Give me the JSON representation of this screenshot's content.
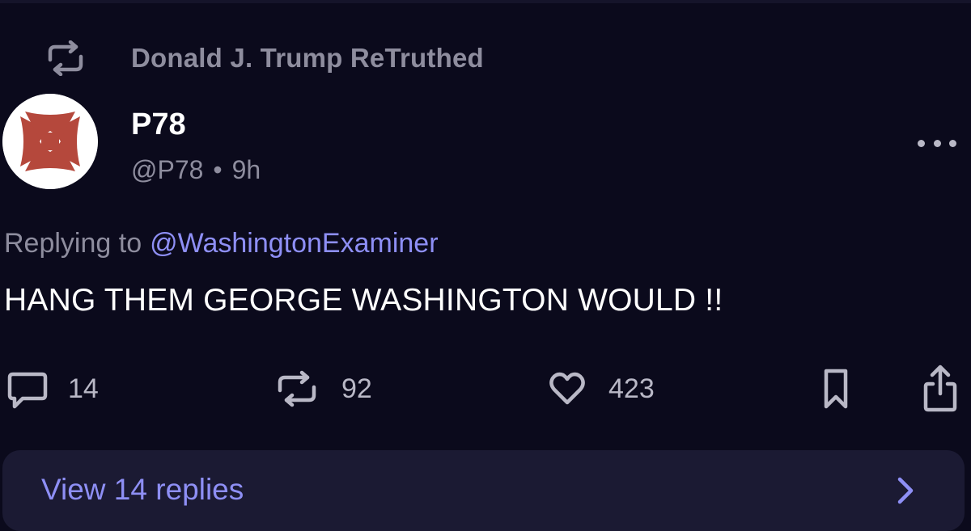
{
  "retruth": {
    "label": "Donald J. Trump ReTruthed",
    "icon": "retruth-icon"
  },
  "author": {
    "name": "P78",
    "handle": "@P78",
    "separator": "•",
    "time": "9h",
    "avatar": "maltese-cross-avatar"
  },
  "post": {
    "reply_prefix": "Replying to",
    "reply_target": "@WashingtonExaminer",
    "text": "HANG THEM GEORGE WASHINGTON WOULD !!"
  },
  "actions": {
    "replies": "14",
    "retruths": "92",
    "likes": "423"
  },
  "replies_bar": {
    "label": "View 14 replies"
  },
  "colors": {
    "background": "#0b0a1c",
    "muted_text": "#8e8d9e",
    "accent": "#8e8ff5",
    "avatar_cross": "#b5483c"
  }
}
